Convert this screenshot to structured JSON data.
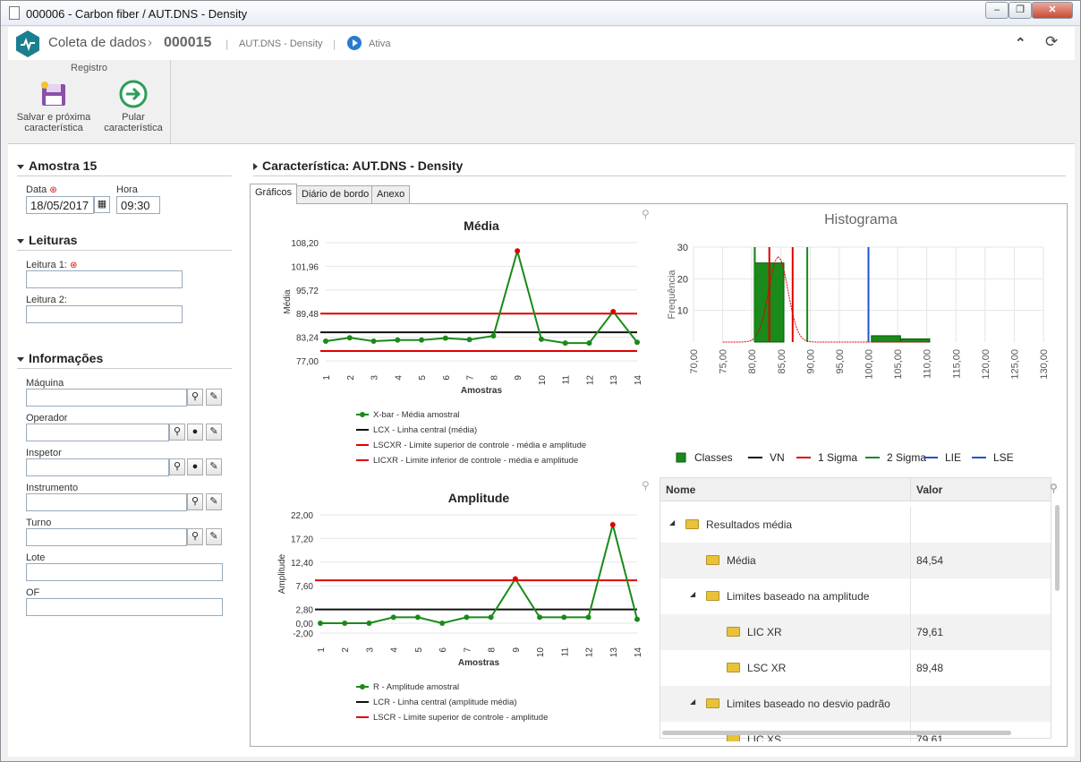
{
  "window": {
    "title": "000006 - Carbon fiber / AUT.DNS - Density"
  },
  "app": {
    "module": "Coleta de dados",
    "record": "000015",
    "item": "AUT.DNS - Density",
    "status": "Ativa"
  },
  "ribbon": {
    "group": "Registro",
    "save_next_line1": "Salvar e próxima",
    "save_next_line2": "característica",
    "skip_line1": "Pular",
    "skip_line2": "característica"
  },
  "left": {
    "sample_title": "Amostra 15",
    "date_label": "Data",
    "date_value": "18/05/2017",
    "time_label": "Hora",
    "time_value": "09:30",
    "readings_title": "Leituras",
    "reading1_label": "Leitura 1:",
    "reading2_label": "Leitura 2:",
    "info_title": "Informações",
    "machine_label": "Máquina",
    "operator_label": "Operador",
    "inspector_label": "Inspetor",
    "instrument_label": "Instrumento",
    "shift_label": "Turno",
    "lot_label": "Lote",
    "of_label": "OF"
  },
  "right": {
    "characteristic_title": "Característica: AUT.DNS - Density",
    "tabs": [
      "Gráficos",
      "Diário de bordo",
      "Anexo"
    ]
  },
  "chart_data": [
    {
      "type": "line",
      "title": "Média",
      "xlabel": "Amostras",
      "ylabel": "Média",
      "x": [
        1,
        2,
        3,
        4,
        5,
        6,
        7,
        8,
        9,
        10,
        11,
        12,
        13,
        14
      ],
      "y_ticks": [
        "108,20",
        "101,96",
        "95,72",
        "89,48",
        "83,24",
        "77,00"
      ],
      "ylim": [
        77.0,
        108.2
      ],
      "series": [
        {
          "name": "X-bar - Média amostral",
          "values": [
            82.2,
            83.1,
            82.2,
            82.5,
            82.5,
            83.0,
            82.6,
            83.6,
            106.0,
            82.7,
            81.7,
            81.7,
            90.0,
            81.9
          ]
        },
        {
          "name": "LCX - Linha central (média)",
          "values": [
            84.54
          ]
        },
        {
          "name": "LSCXR - Limite superior de controle - média e amplitude",
          "values": [
            89.48
          ]
        },
        {
          "name": "LICXR - Limite inferior de controle - média e amplitude",
          "values": [
            79.61
          ]
        }
      ],
      "legend": "bottom"
    },
    {
      "type": "line",
      "title": "Amplitude",
      "xlabel": "Amostras",
      "ylabel": "Amplitude",
      "x": [
        1,
        2,
        3,
        4,
        5,
        6,
        7,
        8,
        9,
        10,
        11,
        12,
        13,
        14
      ],
      "y_ticks": [
        "22,00",
        "17,20",
        "12,40",
        "7,60",
        "2,80",
        "0,00",
        "-2,00"
      ],
      "ylim": [
        -2.0,
        22.0
      ],
      "series": [
        {
          "name": "R - Amplitude amostral",
          "values": [
            0.0,
            0.0,
            0.0,
            1.2,
            1.2,
            0.0,
            1.2,
            1.2,
            9.0,
            1.2,
            1.2,
            1.2,
            20.0,
            0.8
          ]
        },
        {
          "name": "LCR - Linha central (amplitude média)",
          "values": [
            2.8
          ]
        },
        {
          "name": "LSCR - Limite superior de controle - amplitude",
          "values": [
            8.7
          ]
        }
      ],
      "legend": "bottom"
    },
    {
      "type": "bar",
      "title": "Histograma",
      "ylabel": "Frequência",
      "x_ticks": [
        "70,00",
        "75,00",
        "80,00",
        "85,00",
        "90,00",
        "95,00",
        "100,00",
        "105,00",
        "110,00",
        "115,00",
        "120,00",
        "125,00",
        "130,00"
      ],
      "y_ticks": [
        "30",
        "20",
        "10"
      ],
      "ylim": [
        0,
        30
      ],
      "bins": [
        {
          "from": 80.5,
          "to": 85.5,
          "count": 25
        },
        {
          "from": 100.5,
          "to": 105.5,
          "count": 2
        },
        {
          "from": 105.5,
          "to": 110.5,
          "count": 1
        }
      ],
      "lines": {
        "VN": [
          80.5
        ],
        "1 Sigma": [
          83.0,
          87.0
        ],
        "2 Sigma": [
          80.5,
          89.5
        ],
        "LIE": [],
        "LSE": [
          100.0
        ]
      },
      "legend": [
        "Classes",
        "VN",
        "1 Sigma",
        "2 Sigma",
        "LIE",
        "LSE"
      ]
    }
  ],
  "results_grid": {
    "headers": [
      "Nome",
      "Valor"
    ],
    "rows": [
      {
        "name": "Resultados média",
        "value": ""
      },
      {
        "name": "Média",
        "value": "84,54"
      },
      {
        "name": "Limites baseado na amplitude",
        "value": ""
      },
      {
        "name": "LIC XR",
        "value": "79,61"
      },
      {
        "name": "LSC XR",
        "value": "89,48"
      },
      {
        "name": "Limites baseado no desvio padrão",
        "value": ""
      },
      {
        "name": "LIC XS",
        "value": "79,61"
      }
    ]
  },
  "colors": {
    "accent": "#1a7f8e",
    "green": "#1a8a1a",
    "red": "#e00000"
  }
}
